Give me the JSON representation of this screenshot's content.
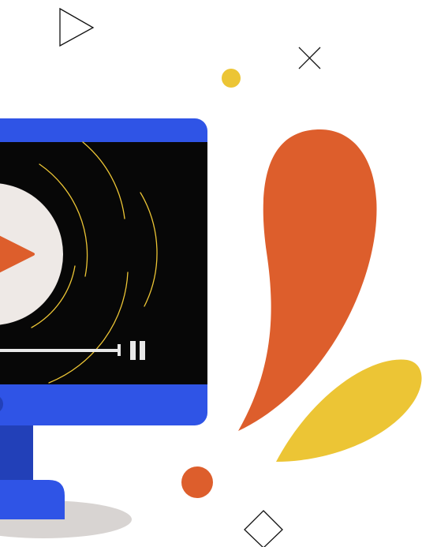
{
  "colors": {
    "background": "#ffffff",
    "monitor_blue": "#2f54e6",
    "stand_dark_blue": "#2240b8",
    "screen_black": "#070707",
    "play_disc": "#eee9e6",
    "accent_orange": "#dd5e2c",
    "accent_yellow": "#ecc535",
    "progress_bar": "#e8e8e8",
    "stand_shadow": "#d8d4d2",
    "outline": "#111111"
  },
  "icons": {
    "play_button": "play-triangle-icon",
    "pause_button": "pause-icon",
    "decor_triangle": "play-outline-icon",
    "decor_cross": "close-cross-icon",
    "decor_diamond": "diamond-outline-icon"
  },
  "player": {
    "state": "paused",
    "progress_fraction": 1.0
  }
}
